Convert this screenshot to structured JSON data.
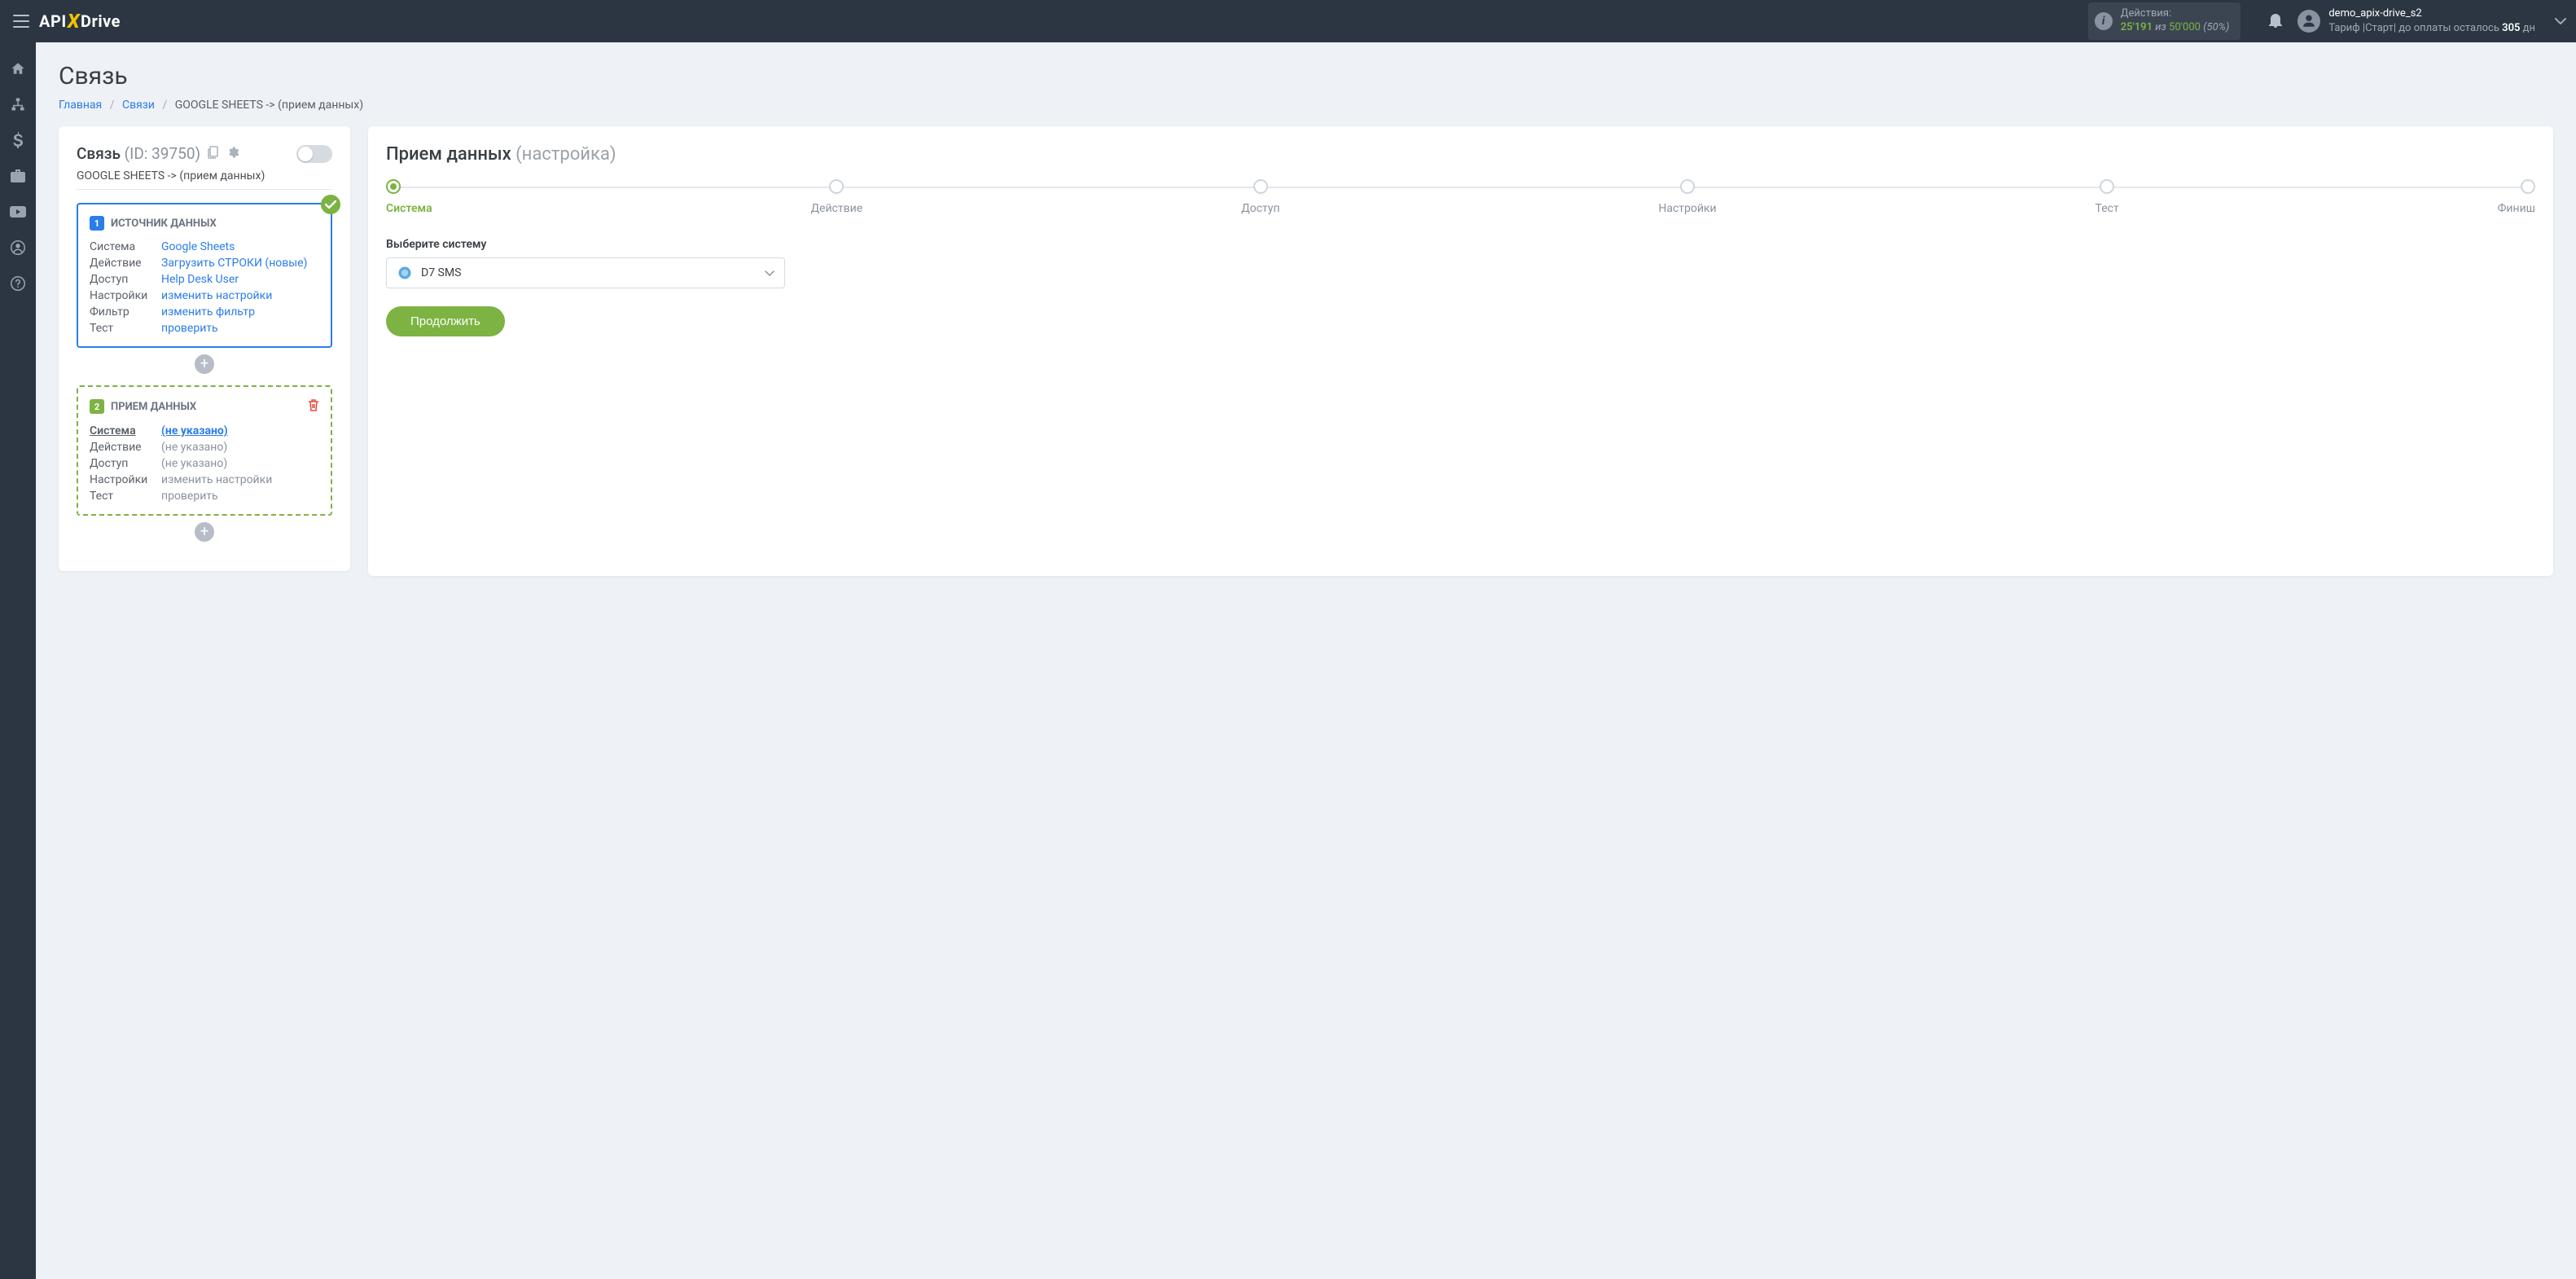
{
  "header": {
    "logo_parts": {
      "a": "API",
      "b": "X",
      "c": "Drive"
    },
    "actions": {
      "title": "Действия:",
      "used": "25'191",
      "of": "из",
      "total": "50'000",
      "pct": "(50%)"
    },
    "user": {
      "name": "demo_apix-drive_s2",
      "plan_prefix": "Тариф |Старт| до оплаты осталось ",
      "days": "305",
      "plan_suffix": " дн"
    }
  },
  "page": {
    "title": "Связь",
    "breadcrumb": {
      "home": "Главная",
      "links": "Связи",
      "current": "GOOGLE SHEETS -> (прием данных)"
    }
  },
  "left": {
    "title": "Связь",
    "id": "(ID: 39750)",
    "subtitle": "GOOGLE SHEETS -> (прием данных)",
    "source": {
      "num": "1",
      "title": "ИСТОЧНИК ДАННЫХ",
      "rows": [
        {
          "label": "Система",
          "val": "Google Sheets"
        },
        {
          "label": "Действие",
          "val": "Загрузить СТРОКИ (новые)"
        },
        {
          "label": "Доступ",
          "val": "Help Desk User"
        },
        {
          "label": "Настройки",
          "val": "изменить настройки"
        },
        {
          "label": "Фильтр",
          "val": "изменить фильтр"
        },
        {
          "label": "Тест",
          "val": "проверить"
        }
      ]
    },
    "dest": {
      "num": "2",
      "title": "ПРИЕМ ДАННЫХ",
      "rows": [
        {
          "label": "Система",
          "val": "(не указано)",
          "current": true
        },
        {
          "label": "Действие",
          "val": "(не указано)",
          "muted": true
        },
        {
          "label": "Доступ",
          "val": "(не указано)",
          "muted": true
        },
        {
          "label": "Настройки",
          "val": "изменить настройки",
          "muted": true
        },
        {
          "label": "Тест",
          "val": "проверить",
          "muted": true
        }
      ]
    }
  },
  "right": {
    "title": "Прием данных",
    "hint": "(настройка)",
    "steps": [
      "Система",
      "Действие",
      "Доступ",
      "Настройки",
      "Тест",
      "Финиш"
    ],
    "select_label": "Выберите систему",
    "select_value": "D7 SMS",
    "btn": "Продолжить"
  }
}
